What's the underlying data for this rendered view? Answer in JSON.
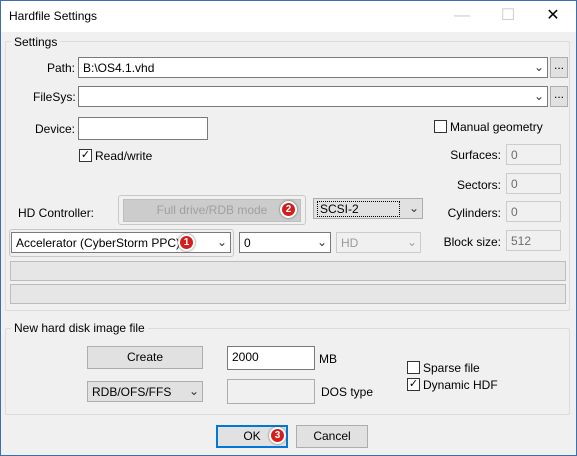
{
  "window": {
    "title": "Hardfile Settings",
    "minimize": "—",
    "maximize": "☐",
    "close": "✕"
  },
  "settings": {
    "group_label": "Settings",
    "path_label": "Path:",
    "path_value": "B:\\OS4.1.vhd",
    "filesys_label": "FileSys:",
    "filesys_value": "",
    "browse_label": "...",
    "device_label": "Device:",
    "device_value": "",
    "readwrite_label": "Read/write",
    "readwrite_checked": true,
    "manual_geometry_label": "Manual geometry",
    "manual_geometry_checked": false,
    "surfaces_label": "Surfaces:",
    "surfaces_value": "0",
    "sectors_label": "Sectors:",
    "sectors_value": "0",
    "cylinders_label": "Cylinders:",
    "cylinders_value": "0",
    "blocksize_label": "Block size:",
    "blocksize_value": "512",
    "hd_controller_label": "HD Controller:",
    "full_drive_label": "Full drive/RDB mode",
    "scsi_value": "SCSI-2",
    "controller_value": "Accelerator (CyberStorm PPC)",
    "unit_value": "0",
    "type_value": "HD",
    "arrow": "⌄",
    "check_mark": "✓"
  },
  "new_disk": {
    "group_label": "New hard disk image file",
    "create_label": "Create",
    "size_value": "2000",
    "size_unit": "MB",
    "format_value": "RDB/OFS/FFS",
    "dostype_value": "",
    "dostype_label": "DOS type",
    "sparse_label": "Sparse file",
    "sparse_checked": false,
    "dynamic_label": "Dynamic HDF",
    "dynamic_checked": true
  },
  "footer": {
    "ok_label": "OK",
    "cancel_label": "Cancel"
  },
  "markers": [
    "1",
    "2",
    "3"
  ]
}
